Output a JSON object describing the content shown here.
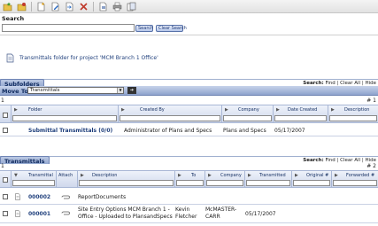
{
  "search": {
    "title": "Search",
    "input_value": "",
    "search_label": "Search",
    "clear_label": "Clear Search"
  },
  "folder": {
    "heading": "Transmittals folder for project 'MCM Branch 1 Office'"
  },
  "subfolders": {
    "section_label": "Subfolders",
    "search_label": "Search:",
    "find": "Find",
    "clear_all": "Clear All",
    "hide": "Hide",
    "move_to_label": "Move To",
    "move_to_value": "Transmittals",
    "go_glyph": "➔",
    "count": "1",
    "right_count": "# 1",
    "columns": [
      "Folder",
      "Created By",
      "Company",
      "Date Created",
      "Description"
    ],
    "rows": [
      {
        "folder": "Submittal Transmittals (0/0)",
        "created_by": "Administrator of Plans and Specs",
        "company": "Plans and Specs",
        "date_created": "05/17/2007",
        "description": ""
      }
    ]
  },
  "transmittals": {
    "section_label": "Transmittals",
    "search_label": "Search:",
    "find": "Find",
    "clear_all": "Clear All",
    "hide": "Hide",
    "count": "1",
    "right_count": "# 2",
    "columns": [
      "Transmittal",
      "Attach",
      "Description",
      "To",
      "Company",
      "Transmitted",
      "Original #",
      "Forwarded #"
    ],
    "rows": [
      {
        "transmittal": "000002",
        "description": "ReportDocuments",
        "to": "",
        "company": "",
        "transmitted": "",
        "original": "",
        "forwarded": ""
      },
      {
        "transmittal": "000001",
        "description_lines": [
          "Site Entry Options MCM Branch 1 -",
          "Office - Uploaded to PlansandSpecs"
        ],
        "to_lines": [
          "Kevin",
          "Fletcher"
        ],
        "company_lines": [
          "McMASTER-",
          "CARR"
        ],
        "transmitted": "05/17/2007",
        "original": "",
        "forwarded": ""
      }
    ]
  }
}
